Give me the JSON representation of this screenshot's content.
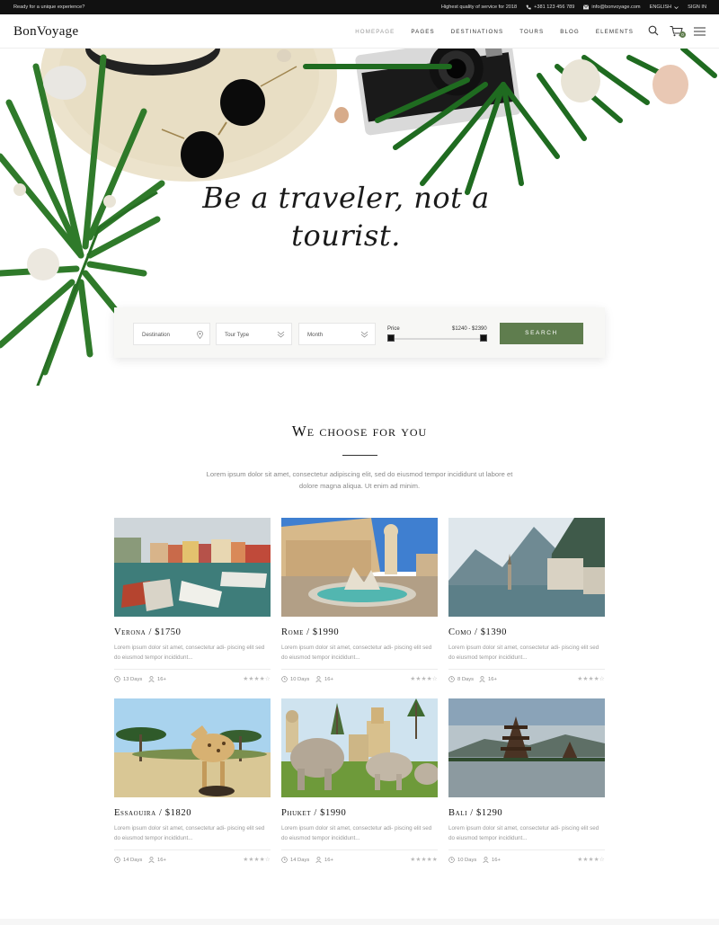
{
  "topbar": {
    "tagline": "Ready for a unique experience?",
    "quality": "Highest quality of service for 2018",
    "phone": "+381 123 456 789",
    "email": "info@bonvoyage.com",
    "language": "ENGLISH",
    "signin": "SIGN IN"
  },
  "header": {
    "logo": "BonVoyage",
    "nav": [
      "HOMEPAGE",
      "PAGES",
      "DESTINATIONS",
      "TOURS",
      "BLOG",
      "ELEMENTS"
    ],
    "cart_count": "0"
  },
  "hero": {
    "title_line1": "Be a traveler, not a",
    "title_line2": "tourist."
  },
  "search": {
    "destination_placeholder": "Destination",
    "tour_type_placeholder": "Tour Type",
    "month_placeholder": "Month",
    "price_label": "Price",
    "price_range": "$1240 - $2390",
    "button_label": "SEARCH"
  },
  "section": {
    "title": "We choose for you",
    "description": "Lorem ipsum dolor sit amet, consectetur adipiscing elit, sed do eiusmod tempor incididunt ut labore et dolore magna aliqua. Ut enim ad minim."
  },
  "tours": [
    {
      "title": "Verona / $1750",
      "desc": "Lorem ipsum dolor sit amet, consectetur adi- piscing elit sed do eiusmod tempor incididunt...",
      "days": "13 Days",
      "age": "16+",
      "rating": "★★★★☆"
    },
    {
      "title": "Rome / $1990",
      "desc": "Lorem ipsum dolor sit amet, consectetur adi- piscing elit sed do eiusmod tempor incididunt...",
      "days": "10 Days",
      "age": "16+",
      "rating": "★★★★☆"
    },
    {
      "title": "Como / $1390",
      "desc": "Lorem ipsum dolor sit amet, consectetur adi- piscing elit sed do eiusmod tempor incididunt...",
      "days": "8 Days",
      "age": "16+",
      "rating": "★★★★☆"
    },
    {
      "title": "Essaouira / $1820",
      "desc": "Lorem ipsum dolor sit amet, consectetur adi- piscing elit sed do eiusmod tempor incididunt...",
      "days": "14 Days",
      "age": "16+",
      "rating": "★★★★☆"
    },
    {
      "title": "Phuket / $1990",
      "desc": "Lorem ipsum dolor sit amet, consectetur adi- piscing elit sed do eiusmod tempor incididunt...",
      "days": "14 Days",
      "age": "16+",
      "rating": "★★★★★"
    },
    {
      "title": "Bali / $1290",
      "desc": "Lorem ipsum dolor sit amet, consectetur adi- piscing elit sed do eiusmod tempor incididunt...",
      "days": "10 Days",
      "age": "16+",
      "rating": "★★★★☆"
    }
  ],
  "colors": {
    "accent": "#5f7d4e",
    "topbar": "#111111",
    "text": "#111111",
    "muted": "#9a9a9a"
  },
  "icons": [
    "phone-icon",
    "mail-icon",
    "chevron-down-icon",
    "search-icon",
    "cart-icon",
    "menu-icon",
    "location-pin-icon",
    "clock-icon",
    "user-icon"
  ]
}
